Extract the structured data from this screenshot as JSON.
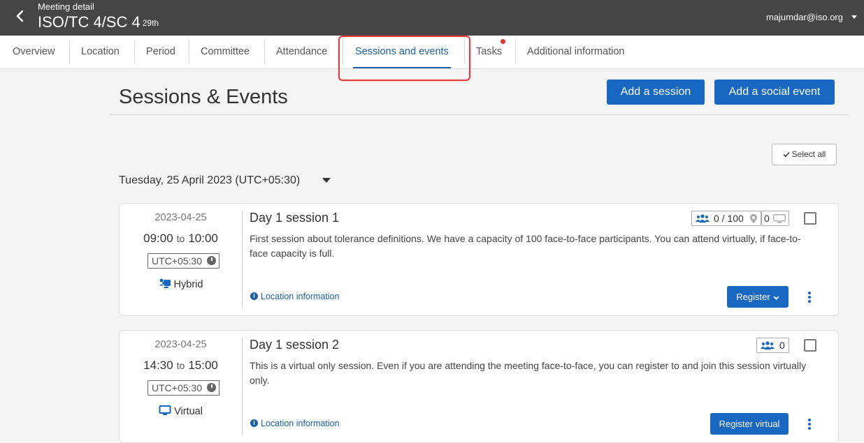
{
  "header": {
    "subtitle": "Meeting detail",
    "title": "ISO/TC 4/SC 4",
    "edition": "29th",
    "user": "majumdar@iso.org"
  },
  "tabs": [
    {
      "label": "Overview"
    },
    {
      "label": "Location"
    },
    {
      "label": "Period"
    },
    {
      "label": "Committee"
    },
    {
      "label": "Attendance"
    },
    {
      "label": "Sessions and events"
    },
    {
      "label": "Tasks"
    },
    {
      "label": "Additional information"
    }
  ],
  "active_tab": "Sessions and events",
  "page": {
    "title": "Sessions & Events",
    "add_session": "Add a session",
    "add_social": "Add a social event",
    "select_all": "Select all",
    "date_group": "Tuesday, 25 April 2023 (UTC+05:30)"
  },
  "sessions": [
    {
      "date": "2023-04-25",
      "start": "09:00",
      "to": "to",
      "end": "10:00",
      "timezone": "UTC+05:30",
      "mode": "Hybrid",
      "title": "Day 1 session 1",
      "description": "First session about tolerance definitions. We have a capacity of 100 face-to-face participants. You can attend virtually, if face-to-face capacity is full.",
      "location_link": "Location information",
      "capacity_f2f": "0 / 100",
      "capacity_virtual": "0",
      "register_label": "Register"
    },
    {
      "date": "2023-04-25",
      "start": "14:30",
      "to": "to",
      "end": "15:00",
      "timezone": "UTC+05:30",
      "mode": "Virtual",
      "title": "Day 1 session 2",
      "description": "This is a virtual only session. Even if you are attending the meeting face-to-face, you can register to and join this session virtually only.",
      "location_link": "Location information",
      "capacity_f2f": "0",
      "register_label": "Register virtual"
    }
  ],
  "colors": {
    "topbar": "#454545",
    "primary": "#1867c0",
    "highlight": "#e53a3a"
  }
}
